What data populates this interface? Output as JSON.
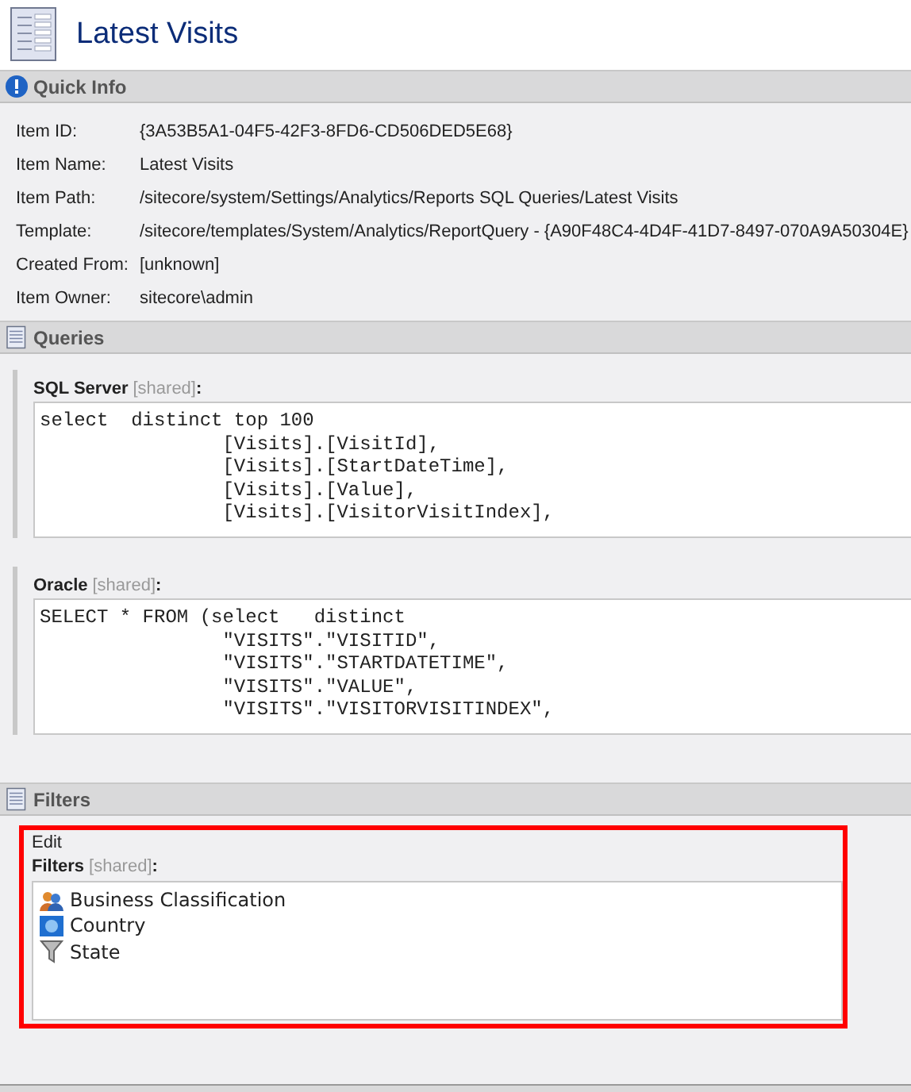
{
  "title": "Latest Visits",
  "quick_info": {
    "heading": "Quick Info",
    "rows": [
      {
        "label": "Item ID:",
        "value": "{3A53B5A1-04F5-42F3-8FD6-CD506DED5E68}"
      },
      {
        "label": "Item Name:",
        "value": "Latest Visits"
      },
      {
        "label": "Item Path:",
        "value": "/sitecore/system/Settings/Analytics/Reports SQL Queries/Latest Visits"
      },
      {
        "label": "Template:",
        "value": "/sitecore/templates/System/Analytics/ReportQuery - {A90F48C4-4D4F-41D7-8497-070A9A50304E}"
      },
      {
        "label": "Created From:",
        "value": "[unknown]"
      },
      {
        "label": "Item Owner:",
        "value": "sitecore\\admin"
      }
    ]
  },
  "queries": {
    "heading": "Queries",
    "fields": [
      {
        "name": "SQL Server",
        "tag": "[shared]",
        "suffix": ":",
        "lines": [
          "select  distinct top 100",
          "                [Visits].[VisitId],",
          "                [Visits].[StartDateTime],",
          "                [Visits].[Value],",
          "                [Visits].[VisitorVisitIndex],"
        ]
      },
      {
        "name": "Oracle",
        "tag": "[shared]",
        "suffix": ":",
        "lines": [
          "SELECT * FROM (select   distinct",
          "                \"VISITS\".\"VISITID\",",
          "                \"VISITS\".\"STARTDATETIME\",",
          "                \"VISITS\".\"VALUE\",",
          "                \"VISITS\".\"VISITORVISITINDEX\","
        ]
      }
    ]
  },
  "filters": {
    "heading": "Filters",
    "highlighted": true,
    "edit": "Edit",
    "name": "Filters",
    "tag": "[shared]",
    "suffix": ":",
    "items": [
      {
        "kind": "people",
        "label": "Business Classification"
      },
      {
        "kind": "globe",
        "label": "Country"
      },
      {
        "kind": "funnel",
        "label": "State"
      }
    ]
  }
}
